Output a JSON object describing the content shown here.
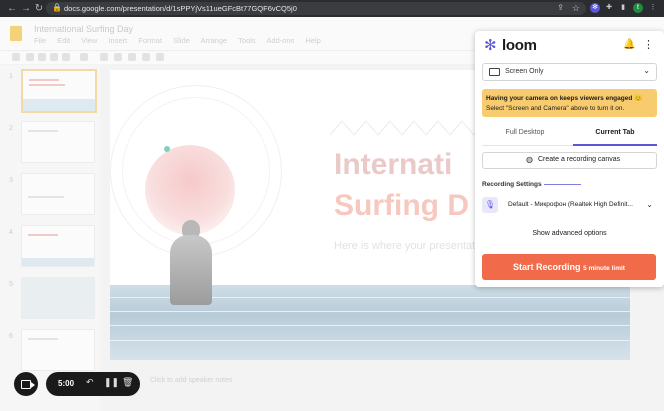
{
  "browser": {
    "url": "docs.google.com/presentation/d/1sPPYjVs11ueGFcBt77GQF6vCQ5j0",
    "extension_initial": "t"
  },
  "docs": {
    "title": "International Surfing Day",
    "menu": [
      "File",
      "Edit",
      "View",
      "Insert",
      "Format",
      "Slide",
      "Arrange",
      "Tools",
      "Add-ons",
      "Help"
    ],
    "slide_numbers": [
      "1",
      "2",
      "3",
      "4",
      "5",
      "6"
    ],
    "slide": {
      "title_line1": "Internati",
      "title_line2": "Surfing D",
      "subtitle": "Here is where your presentati"
    },
    "notes": "Click to add speaker notes"
  },
  "recorder": {
    "timer": "5:00"
  },
  "loom": {
    "brand": "loom",
    "capture_mode": "Screen Only",
    "tip_heading": "Having your camera on keeps viewers engaged",
    "tip_emoji": "😊",
    "tip_body": "Select \"Screen and Camera\" above to turn it on.",
    "tabs": [
      "Full Desktop",
      "Current Tab"
    ],
    "active_tab": "Current Tab",
    "canvas_button": "Create a recording canvas",
    "recording_settings_label": "Recording Settings",
    "microphone": "Default - Микрофон (Realtek High Definit...",
    "advanced_link": "Show advanced options",
    "start_label": "Start Recording",
    "start_limit": "5 minute limit",
    "colors": {
      "accent": "#5b57d9",
      "start": "#f16a4a",
      "tip": "#f8cb6f"
    }
  }
}
